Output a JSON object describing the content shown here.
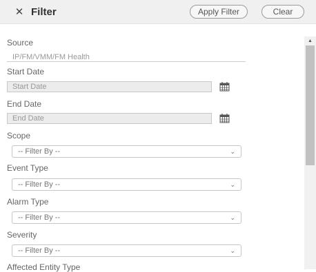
{
  "header": {
    "close_icon": "✕",
    "title": "Filter",
    "apply_label": "Apply Filter",
    "clear_label": "Clear"
  },
  "form": {
    "source_label": "Source",
    "source_value": "IP/FM/VMM/FM Health",
    "start_date_label": "Start Date",
    "start_date_placeholder": "Start Date",
    "end_date_label": "End Date",
    "end_date_placeholder": "End Date",
    "scope_label": "Scope",
    "scope_value": "-- Filter By --",
    "event_type_label": "Event Type",
    "event_type_value": "-- Filter By --",
    "alarm_type_label": "Alarm Type",
    "alarm_type_value": "-- Filter By --",
    "severity_label": "Severity",
    "severity_value": "-- Filter By --",
    "affected_entity_label": "Affected Entity Type"
  },
  "icons": {
    "calendar": "calendar-icon",
    "caret": "chevron-down-icon",
    "caret_glyph": "⌄",
    "scroll_up_glyph": "▲"
  }
}
